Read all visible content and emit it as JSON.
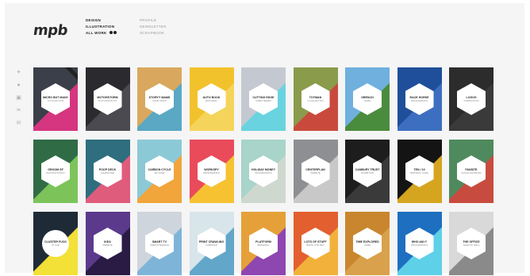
{
  "brand": {
    "logo_text": "mpb"
  },
  "nav": {
    "primary": [
      "DESIGN",
      "ILLUSTRATION",
      "ALL WORK"
    ],
    "secondary": [
      "PROFILE",
      "NEWSLETTER",
      "SCRAPBOOK"
    ]
  },
  "social": [
    "twitter-icon",
    "dribbble-icon",
    "instagram-icon",
    "linkedin-icon",
    "email-icon"
  ],
  "cards": [
    {
      "title": "MICRO BUT MANY",
      "subtitle": "A COLLECTION",
      "bg": "#3a3f49",
      "accent": "#d6357f",
      "new": true
    },
    {
      "title": "MOTORSTORM",
      "subtitle": "PLAYSTATION KIT",
      "bg": "#2b2b2f",
      "accent": "#4a4a50"
    },
    {
      "title": "STORYY WAMS",
      "subtitle": "COMIC BOOK",
      "bg": "#d9a85e",
      "accent": "#5aa8c4"
    },
    {
      "title": "AUTO BOOK",
      "subtitle": "EDITORIAL",
      "bg": "#f2c22c",
      "accent": "#f5d45b"
    },
    {
      "title": "CUTTING EDGE",
      "subtitle": "VIDEO SERIES",
      "bg": "#c4c9d1",
      "accent": "#6ad3e0"
    },
    {
      "title": "TOYMAN",
      "subtitle": "A COLLECTION",
      "bg": "#8a9b4b",
      "accent": "#c94a3c"
    },
    {
      "title": "DRENCH",
      "subtitle": "GAME",
      "bg": "#6fb0de",
      "accent": "#4a8c3d"
    },
    {
      "title": "RACE HORSE",
      "subtitle": "INFOGRAPHICS",
      "bg": "#1f4f9a",
      "accent": "#3d6fc0"
    },
    {
      "title": "LOGOS",
      "subtitle": "COMPILATION",
      "bg": "#2c2c2c",
      "accent": "#3a3a3a"
    },
    {
      "title": "GROOM SF",
      "subtitle": "PLAYSTATION KIT",
      "bg": "#2f6b45",
      "accent": "#7cc45a"
    },
    {
      "title": "POOP DECK",
      "subtitle": "CHARACTER",
      "bg": "#2e6e7e",
      "accent": "#e05c7c"
    },
    {
      "title": "CARBON CYCLE",
      "subtitle": "AR GAME",
      "bg": "#8cc9d6",
      "accent": "#f1a53a"
    },
    {
      "title": "WORKSPY",
      "subtitle": "INFOGRAPHICS",
      "bg": "#e94b5a",
      "accent": "#f6c232"
    },
    {
      "title": "HOLIDAY MONEY",
      "subtitle": "INFOGRAPHICS",
      "bg": "#a8d4c9",
      "accent": "#cfd8cf"
    },
    {
      "title": "CENTERPLAN",
      "subtitle": "WEBSITE",
      "bg": "#8d8f92",
      "accent": "#c8c8c8"
    },
    {
      "title": "CANBURY TRUST",
      "subtitle": "EXHIBITION",
      "bg": "#1d1d1d",
      "accent": "#3a3a3a"
    },
    {
      "title": "TEN / 10",
      "subtitle": "BIRTHDAY CARD",
      "bg": "#141414",
      "accent": "#d6a520"
    },
    {
      "title": "FANSITE",
      "subtitle": "SOCIAL NETWORK",
      "bg": "#4f8a5e",
      "accent": "#c84b3f"
    },
    {
      "title": "CLUSTER FUCK",
      "subtitle": "IN CAR",
      "bg": "#1e2a36",
      "accent": "#f3e137",
      "round": true
    },
    {
      "title": "IKEA",
      "subtitle": "WEBSITE",
      "bg": "#5b3a8c",
      "accent": "#2a1b44"
    },
    {
      "title": "SMART TV",
      "subtitle": "USER INTERFACE",
      "bg": "#cfd5dc",
      "accent": "#7fb4d9"
    },
    {
      "title": "PRINT CRAWLING",
      "subtitle": "CAMPAIGN",
      "bg": "#d8e5ea",
      "accent": "#62a6c9"
    },
    {
      "title": "PLATFORM",
      "subtitle": "BRANDING",
      "bg": "#e6a03a",
      "accent": "#8e46b0"
    },
    {
      "title": "LOTS OF STUFF",
      "subtitle": "RETAIL POP BOX",
      "bg": "#e35f2f",
      "accent": "#f2b13a"
    },
    {
      "title": "TIME EXPLORED",
      "subtitle": "GAME",
      "bg": "#c9862e",
      "accent": "#d9a14b"
    },
    {
      "title": "WHO AM I?",
      "subtitle": "INFOGRAPHICS",
      "bg": "#1e6fc0",
      "accent": "#5ed0e8"
    },
    {
      "title": "THE OFFICE",
      "subtitle": "GRAFFITI WALL",
      "bg": "#d9d9d9",
      "accent": "#8a8a8a"
    }
  ]
}
